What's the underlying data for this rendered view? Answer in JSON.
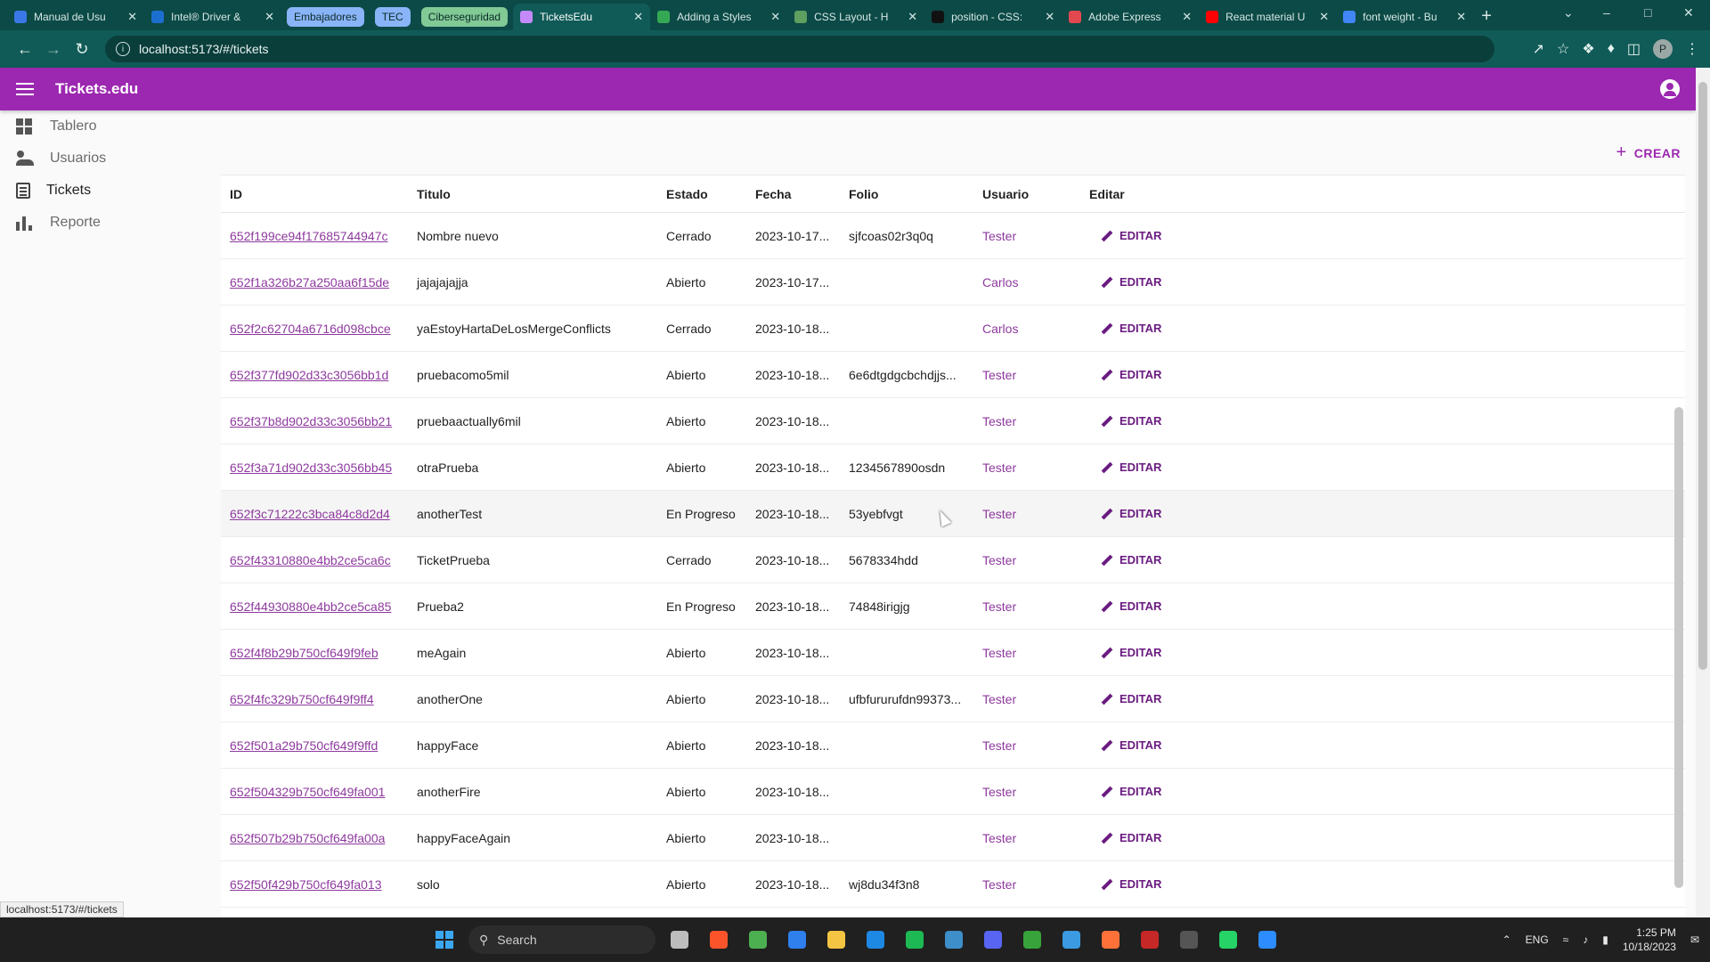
{
  "browser": {
    "tabs": [
      {
        "label": "Manual de Usu",
        "fav": "#3b78e7"
      },
      {
        "label": "Intel® Driver &",
        "fav": "#1d6fcf"
      }
    ],
    "groups": [
      {
        "label": "Embajadores",
        "color": "#8ab4f8"
      },
      {
        "label": "TEC",
        "color": "#8ab4f8"
      },
      {
        "label": "Ciberseguridad",
        "color": "#81c995"
      }
    ],
    "tabs_after": [
      {
        "label": "TicketsEdu",
        "fav": "#c58af9",
        "active": true
      },
      {
        "label": "Adding a Styles",
        "fav": "#34a853"
      },
      {
        "label": "CSS Layout - H",
        "fav": "#5f9f5f"
      },
      {
        "label": "position - CSS:",
        "fav": "#111111"
      },
      {
        "label": "Adobe Express",
        "fav": "#e34850"
      },
      {
        "label": "React material U",
        "fav": "#ff0000"
      },
      {
        "label": "font weight - Bu",
        "fav": "#4285f4"
      }
    ],
    "url": "localhost:5173/#/tickets",
    "profile_initial": "P"
  },
  "app": {
    "title": "Tickets.edu",
    "create_label": "CREAR",
    "edit_label": "EDITAR"
  },
  "sidebar": {
    "items": [
      {
        "label": "Tablero",
        "icon": "dashboard-icon"
      },
      {
        "label": "Usuarios",
        "icon": "users-icon"
      },
      {
        "label": "Tickets",
        "icon": "tickets-icon"
      },
      {
        "label": "Reporte",
        "icon": "bar-chart-icon"
      }
    ]
  },
  "table": {
    "columns": [
      "ID",
      "Titulo",
      "Estado",
      "Fecha",
      "Folio",
      "Usuario",
      "Editar"
    ],
    "rows": [
      {
        "id": "652f199ce94f17685744947c",
        "title": "Nombre nuevo",
        "state": "Cerrado",
        "date": "2023-10-17...",
        "folio": "sjfcoas02r3q0q",
        "user": "Tester"
      },
      {
        "id": "652f1a326b27a250aa6f15de",
        "title": "jajajajajja",
        "state": "Abierto",
        "date": "2023-10-17...",
        "folio": "",
        "user": "Carlos"
      },
      {
        "id": "652f2c62704a6716d098cbce",
        "title": "yaEstoyHartaDeLosMergeConflicts",
        "state": "Cerrado",
        "date": "2023-10-18...",
        "folio": "",
        "user": "Carlos"
      },
      {
        "id": "652f377fd902d33c3056bb1d",
        "title": "pruebacomo5mil",
        "state": "Abierto",
        "date": "2023-10-18...",
        "folio": "6e6dtgdgcbchdjjs...",
        "user": "Tester"
      },
      {
        "id": "652f37b8d902d33c3056bb21",
        "title": "pruebaactually6mil",
        "state": "Abierto",
        "date": "2023-10-18...",
        "folio": "",
        "user": "Tester"
      },
      {
        "id": "652f3a71d902d33c3056bb45",
        "title": "otraPrueba",
        "state": "Abierto",
        "date": "2023-10-18...",
        "folio": "1234567890osdn",
        "user": "Tester"
      },
      {
        "id": "652f3c71222c3bca84c8d2d4",
        "title": "anotherTest",
        "state": "En Progreso",
        "date": "2023-10-18...",
        "folio": "53yebfvgt",
        "user": "Tester",
        "hover": true
      },
      {
        "id": "652f43310880e4bb2ce5ca6c",
        "title": "TicketPrueba",
        "state": "Cerrado",
        "date": "2023-10-18...",
        "folio": "5678334hdd",
        "user": "Tester"
      },
      {
        "id": "652f44930880e4bb2ce5ca85",
        "title": "Prueba2",
        "state": "En Progreso",
        "date": "2023-10-18...",
        "folio": "74848irigjg",
        "user": "Tester"
      },
      {
        "id": "652f4f8b29b750cf649f9feb",
        "title": "meAgain",
        "state": "Abierto",
        "date": "2023-10-18...",
        "folio": "",
        "user": "Tester"
      },
      {
        "id": "652f4fc329b750cf649f9ff4",
        "title": "anotherOne",
        "state": "Abierto",
        "date": "2023-10-18...",
        "folio": "ufbfururufdn99373...",
        "user": "Tester"
      },
      {
        "id": "652f501a29b750cf649f9ffd",
        "title": "happyFace",
        "state": "Abierto",
        "date": "2023-10-18...",
        "folio": "",
        "user": "Tester"
      },
      {
        "id": "652f504329b750cf649fa001",
        "title": "anotherFire",
        "state": "Abierto",
        "date": "2023-10-18...",
        "folio": "",
        "user": "Tester"
      },
      {
        "id": "652f507b29b750cf649fa00a",
        "title": "happyFaceAgain",
        "state": "Abierto",
        "date": "2023-10-18...",
        "folio": "",
        "user": "Tester"
      },
      {
        "id": "652f50f429b750cf649fa013",
        "title": "solo",
        "state": "Abierto",
        "date": "2023-10-18...",
        "folio": "wj8du34f3n8",
        "user": "Tester"
      }
    ]
  },
  "status_url": "localhost:5173/#/tickets",
  "taskbar": {
    "search_placeholder": "Search",
    "apps": [
      {
        "name": "file-manager-icon",
        "color": "#bdbdbd"
      },
      {
        "name": "brave-icon",
        "color": "#fb542b"
      },
      {
        "name": "chrome-icon",
        "color": "#4caf50"
      },
      {
        "name": "vscode-icon",
        "color": "#2f80ed"
      },
      {
        "name": "folder-icon",
        "color": "#f4c542"
      },
      {
        "name": "chrome-active-icon",
        "color": "#1e88e5"
      },
      {
        "name": "spotify-icon",
        "color": "#1db954"
      },
      {
        "name": "steam-icon",
        "color": "#3d8ec9"
      },
      {
        "name": "discord-icon",
        "color": "#5865f2"
      },
      {
        "name": "xbox-icon",
        "color": "#37a33a"
      },
      {
        "name": "store-icon",
        "color": "#3b9ae1"
      },
      {
        "name": "firefox-icon",
        "color": "#ff7139"
      },
      {
        "name": "app-red-icon",
        "color": "#c62828"
      },
      {
        "name": "terminal-icon",
        "color": "#555555"
      },
      {
        "name": "whatsapp-icon",
        "color": "#25d366"
      },
      {
        "name": "zoom-icon",
        "color": "#2d8cff"
      }
    ],
    "lang": "ENG",
    "time": "1:25 PM",
    "date": "10/18/2023"
  }
}
